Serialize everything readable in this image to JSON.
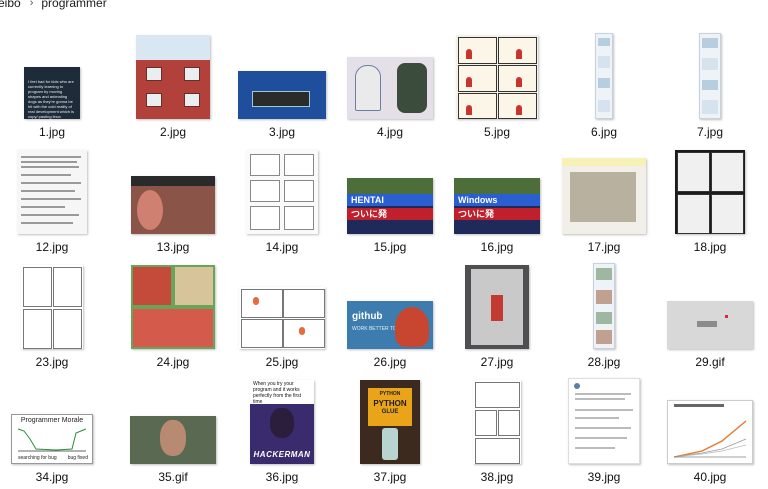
{
  "breadcrumb": {
    "segments": [
      "eibo",
      "programmer"
    ],
    "separator": "›"
  },
  "files": [
    {
      "name": "1.jpg"
    },
    {
      "name": "2.jpg"
    },
    {
      "name": "3.jpg"
    },
    {
      "name": "4.jpg"
    },
    {
      "name": "5.jpg"
    },
    {
      "name": "6.jpg"
    },
    {
      "name": "7.jpg"
    },
    {
      "name": "12.jpg"
    },
    {
      "name": "13.jpg"
    },
    {
      "name": "14.jpg"
    },
    {
      "name": "15.jpg"
    },
    {
      "name": "16.jpg"
    },
    {
      "name": "17.jpg"
    },
    {
      "name": "18.jpg"
    },
    {
      "name": "23.jpg"
    },
    {
      "name": "24.jpg"
    },
    {
      "name": "25.jpg"
    },
    {
      "name": "26.jpg"
    },
    {
      "name": "27.jpg"
    },
    {
      "name": "28.jpg"
    },
    {
      "name": "29.gif"
    },
    {
      "name": "34.jpg"
    },
    {
      "name": "35.gif"
    },
    {
      "name": "36.jpg"
    },
    {
      "name": "37.jpg"
    },
    {
      "name": "38.jpg"
    },
    {
      "name": "39.jpg"
    },
    {
      "name": "40.jpg"
    }
  ],
  "thumb_text": {
    "tweet_author": "I Am Devloper",
    "tweet_body": "I feel bad for kids who are currently learning to program by moving shapes and animating dogs as they're gonna be hit with the cold reality of real development which is copy/ pasting linux commands and resolving git merge conflicts.",
    "hentai_word": "HENTAI",
    "hentai_jp": "ついに発",
    "windows_word": "Windows",
    "windows_jp": "ついに発",
    "github_word": "github",
    "github_sub": "WORK BETTER TOGETHER",
    "morale_title": "Programmer Morale",
    "morale_left": "searching for bug",
    "morale_right": "bug fixed",
    "hacker_text": "When you try your program and it works perfectly from the first time",
    "hacker_logo": "HACKERMAN",
    "python_top": "PYTHON",
    "python_word": "PYTHON",
    "python_sub": "GLUE"
  }
}
